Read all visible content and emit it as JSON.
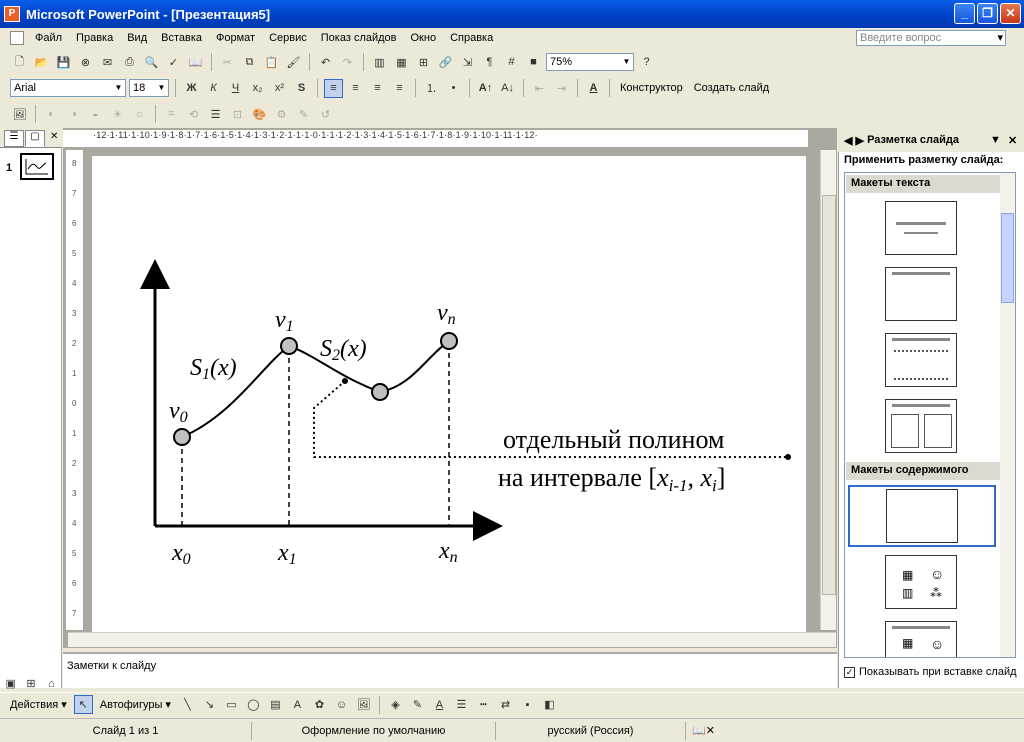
{
  "window": {
    "title": "Microsoft PowerPoint - [Презентация5]",
    "app_icon": "P"
  },
  "menu": {
    "items": [
      "Файл",
      "Правка",
      "Вид",
      "Вставка",
      "Формат",
      "Сервис",
      "Показ слайдов",
      "Окно",
      "Справка"
    ],
    "help_placeholder": "Введите вопрос"
  },
  "toolbar": {
    "zoom": "75%",
    "font": "Arial",
    "font_size": "18",
    "bold": "Ж",
    "italic": "К",
    "underline": "Ч",
    "shadow": "S",
    "designer": "Конструктор",
    "new_slide": "Создать слайд"
  },
  "left_pane": {
    "slide_number": "1"
  },
  "slide": {
    "v0": "v",
    "v0_sub": "0",
    "v1": "v",
    "v1_sub": "1",
    "vn": "v",
    "vn_sub": "n",
    "s1": "S",
    "s1_sub": "1",
    "s1_arg": "(x)",
    "s2": "S",
    "s2_sub": "2",
    "s2_arg": "(x)",
    "x0": "x",
    "x0_sub": "0",
    "x1": "x",
    "x1_sub": "1",
    "xn": "x",
    "xn_sub": "n",
    "caption1": "отдельный полином",
    "caption2_prefix": "на интервале [",
    "caption2_x1": "x",
    "caption2_sub1": "i-1",
    "caption2_comma": ", ",
    "caption2_x2": "x",
    "caption2_sub2": "i",
    "caption2_suffix": "]"
  },
  "notes": {
    "placeholder": "Заметки к слайду"
  },
  "task_pane": {
    "title": "Разметка слайда",
    "apply_label": "Применить разметку слайда:",
    "section_text": "Макеты текста",
    "section_content": "Макеты содержимого",
    "show_on_insert": "Показывать при вставке слайд"
  },
  "drawing": {
    "actions": "Действия",
    "autoshapes": "Автофигуры"
  },
  "status": {
    "slide": "Слайд 1 из 1",
    "design": "Оформление по умолчанию",
    "language": "русский (Россия)"
  }
}
